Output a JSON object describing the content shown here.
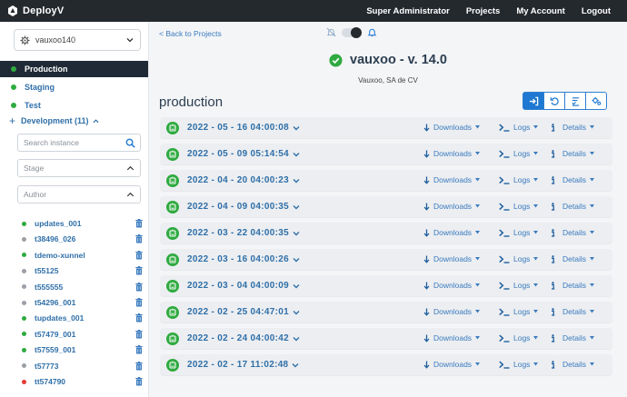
{
  "navbar": {
    "brand": "DeployV",
    "links": [
      "Super Administrator",
      "Projects",
      "My Account",
      "Logout"
    ]
  },
  "sidebar": {
    "db_select": "vauxoo140",
    "stages": [
      {
        "label": "Production",
        "active": true
      },
      {
        "label": "Staging",
        "active": false
      },
      {
        "label": "Test",
        "active": false
      }
    ],
    "development_label": "Development (11)",
    "search_placeholder": "Search instance",
    "stage_placeholder": "Stage",
    "author_placeholder": "Author",
    "instances": [
      {
        "name": "updates_001",
        "status": "green"
      },
      {
        "name": "t38496_026",
        "status": "gray"
      },
      {
        "name": "tdemo-xunnel",
        "status": "green"
      },
      {
        "name": "t55125",
        "status": "gray"
      },
      {
        "name": "t555555",
        "status": "gray"
      },
      {
        "name": "t54296_001",
        "status": "gray"
      },
      {
        "name": "tupdates_001",
        "status": "green"
      },
      {
        "name": "t57479_001",
        "status": "green"
      },
      {
        "name": "t57559_001",
        "status": "green"
      },
      {
        "name": "t57773",
        "status": "gray"
      },
      {
        "name": "tt574790",
        "status": "red"
      }
    ]
  },
  "main": {
    "back_link": "< Back to Projects",
    "project_title": "vauxoo - v. 14.0",
    "company": "Vauxoo, SA de CV",
    "environment_title": "production",
    "actions": {
      "downloads": "Downloads",
      "logs": "Logs",
      "details": "Details"
    },
    "builds": [
      "2022 - 05 - 16 04:00:08",
      "2022 - 05 - 09 05:14:54",
      "2022 - 04 - 20 04:00:23",
      "2022 - 04 - 09 04:00:35",
      "2022 - 03 - 22 04:00:35",
      "2022 - 03 - 16 04:00:26",
      "2022 - 03 - 04 04:00:09",
      "2022 - 02 - 25 04:47:01",
      "2022 - 02 - 24 04:00:42",
      "2022 - 02 - 17 11:02:48"
    ]
  },
  "colors": {
    "navbar": "#24292e",
    "active_stage": "#1f2a36",
    "status_green": "#2eaa3f",
    "status_gray": "#9aa0a6",
    "status_red": "#e53935",
    "link_blue": "#2f6fa8",
    "accent_blue": "#1f78d1"
  },
  "icons": {
    "brand": "deployv-logo-icon",
    "db": "gear-icon",
    "search": "search-icon",
    "notifications": "bell-icon",
    "status_ok": "check-circle-icon",
    "build": "build-robot-icon",
    "downloads": "download-arrow-icon",
    "logs": "terminal-icon",
    "details": "info-icon",
    "delete": "trash-icon"
  }
}
